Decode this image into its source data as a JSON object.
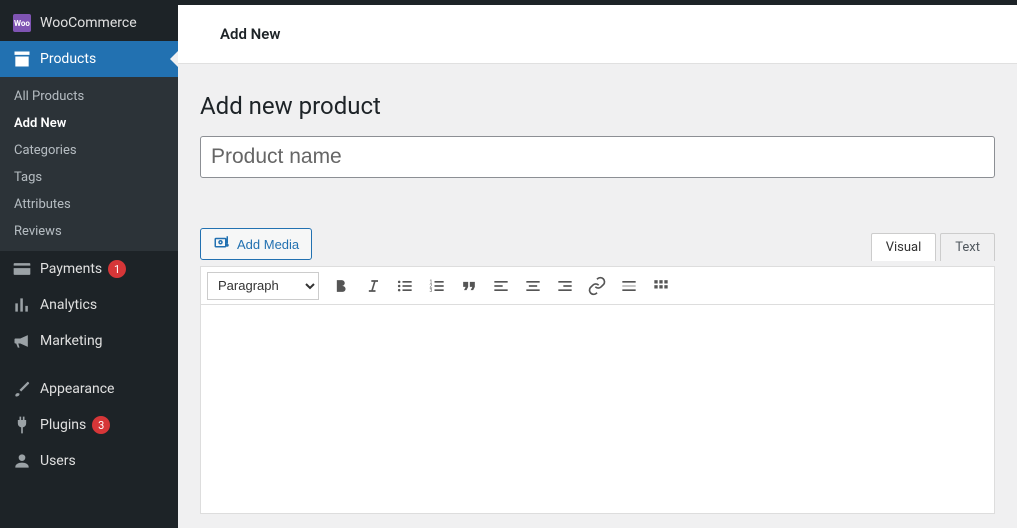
{
  "sidebar": {
    "woocommerce": "WooCommerce",
    "products": "Products",
    "products_sub": [
      {
        "label": "All Products",
        "current": false
      },
      {
        "label": "Add New",
        "current": true
      },
      {
        "label": "Categories",
        "current": false
      },
      {
        "label": "Tags",
        "current": false
      },
      {
        "label": "Attributes",
        "current": false
      },
      {
        "label": "Reviews",
        "current": false
      }
    ],
    "payments": {
      "label": "Payments",
      "badge": "1"
    },
    "analytics": "Analytics",
    "marketing": "Marketing",
    "appearance": "Appearance",
    "plugins": {
      "label": "Plugins",
      "badge": "3"
    },
    "users": "Users"
  },
  "header": {
    "title": "Add New"
  },
  "main": {
    "heading": "Add new product",
    "product_name_placeholder": "Product name",
    "add_media": "Add Media",
    "format_selected": "Paragraph",
    "tabs": {
      "visual": "Visual",
      "text": "Text"
    }
  }
}
